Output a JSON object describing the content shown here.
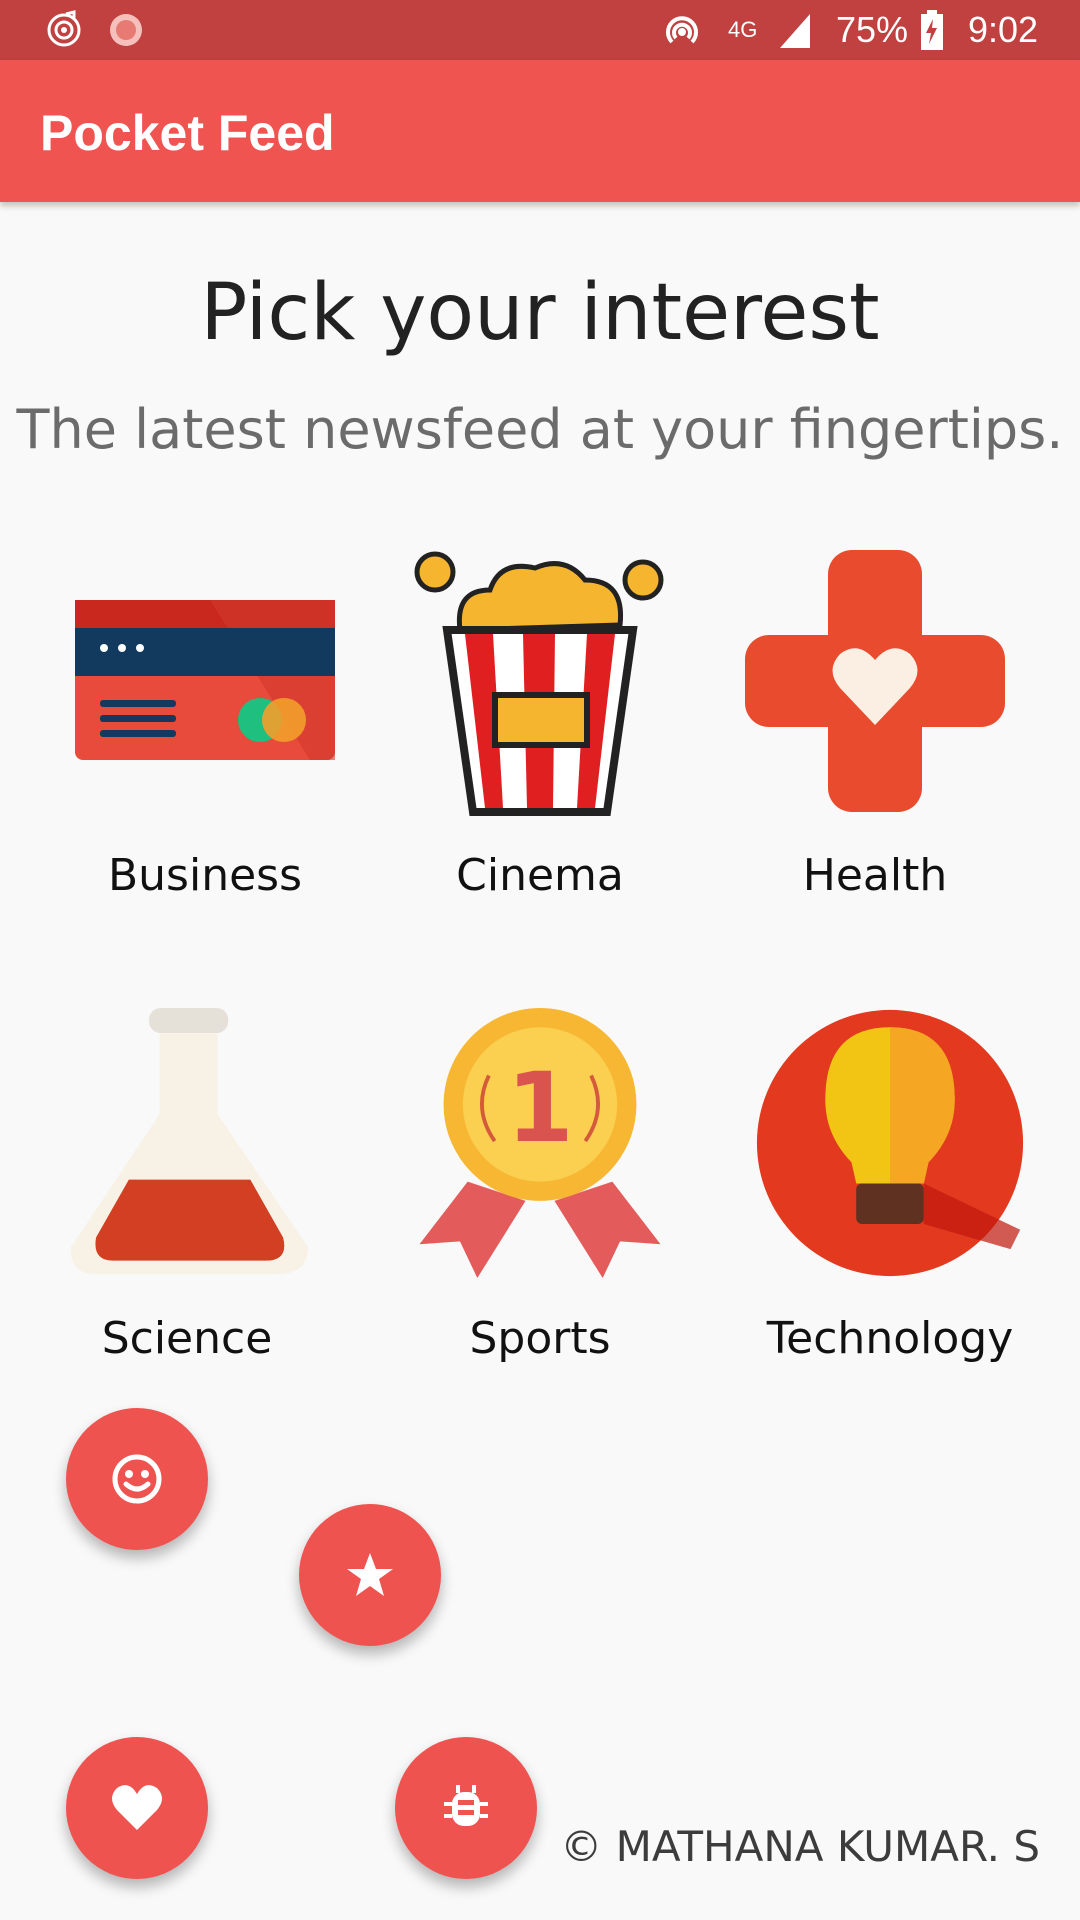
{
  "status_bar": {
    "network": "4G",
    "battery": "75%",
    "time": "9:02"
  },
  "app_bar": {
    "title": "Pocket Feed"
  },
  "main": {
    "heading": "Pick your interest",
    "subheading": "The latest newsfeed at your fingertips."
  },
  "categories": [
    {
      "label": "Business",
      "icon": "credit-card-icon"
    },
    {
      "label": "Cinema",
      "icon": "popcorn-icon"
    },
    {
      "label": "Health",
      "icon": "medical-cross-heart-icon"
    },
    {
      "label": "Science",
      "icon": "flask-icon"
    },
    {
      "label": "Sports",
      "icon": "medal-icon"
    },
    {
      "label": "Technology",
      "icon": "light-bulb-icon"
    }
  ],
  "fabs": [
    {
      "icon": "smiley-icon"
    },
    {
      "icon": "star-icon"
    },
    {
      "icon": "heart-icon"
    },
    {
      "icon": "bug-icon"
    }
  ],
  "footer": {
    "copyright": "© MATHANA KUMAR. S"
  },
  "colors": {
    "status_bar": "#c0413f",
    "app_bar": "#f05451",
    "fab": "#ef5350",
    "background": "#f9f9f9"
  }
}
